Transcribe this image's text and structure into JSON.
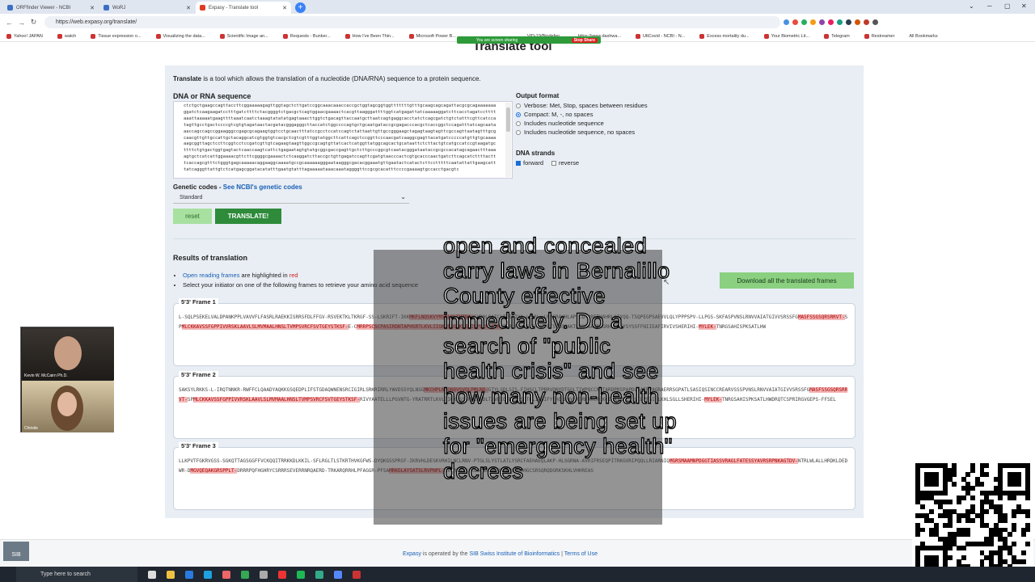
{
  "browser": {
    "tabs": [
      {
        "title": "ORFfinder Viewer - NCBI"
      },
      {
        "title": "WoRJ"
      },
      {
        "title": "Expasy - Translate tool",
        "active": true
      }
    ],
    "url": "https://web.expasy.org/translate/",
    "bookmarks": [
      "Yahoo! JAPAN",
      "watch",
      "Tissue expression o...",
      "Visualizing the data...",
      "Scientific Image an...",
      "Requests - Bunker...",
      "How I've Been Thin...",
      "Microsoft Power B...",
      "VID-19/Biodefen...",
      "https://www.dashwa...",
      "UltCovid - NCBI - N...",
      "Excess mortality du...",
      "Your Biometric Lit...",
      "Telegram",
      "Restreamer",
      "All Bookmarks"
    ],
    "share_text": "You are screen sharing",
    "stop_share": "Stop Share"
  },
  "page": {
    "title": "Translate tool",
    "intro_bold": "Translate",
    "intro_rest": " is a tool which allows the translation of a nucleotide (DNA/RNA) sequence to a protein sequence.",
    "seq_label": "DNA or RNA sequence",
    "sequence": "ctctgctgaagccagttaccttcggaaaaagagttggtagctcttgatccggcaaacaaaccaccgctggtagcggtggtttttttgtttgcaagcagcagattacgcgcagaaaaaaaggatctcaagaagatcctttgatcttttctacggggtctgacgctcagtggaacgaaaactcacgttaagggattttggtcatgagattatcaaaaaggatcttcacctagatccttttaaattaaaaatgaagttttaaatcaatctaaagtatatatgagtaaacttggtctgacagttaccaatgcttaatcagtgaggcacctatctcagcgatctgtctatttcgttcatccatagttgcctgactccccgtcgtgtagataactacgatacgggagggcttaccatctggccccagtgctgcaatgataccgcgagacccacgctcaccggctccagatttatcagcaataaaccagccagccggaagggccgagcgcagaagtggtcctgcaactttatccgcctccatccagtctattaattgttgccgggaagctagagtaagtagttcgccagttaatagtttgcgcaacgttgttgccattgctacaggcatcgtggtgtcacgctcgtcgtttggtatggcttcattcagctccggttcccaacgatcaaggcgagttacatgatcccccatgttgtgcaaaaaagcggttagctccttcggtcctccgatcgttgtcagaagtaagttggccgcagtgttatcactcatggttatggcagcactgcataattctcttactgtcatgccatccgtaagatgcttttctgtgactggtgagtactcaaccaagtcattctgagaatagtgtatgcggcgaccgagttgctcttgcccggcgtcaatacgggataataccgcgccacatagcagaactttaaaagtgctcatcattggaaaacgttcttcggggcgaaaactctcaaggatcttaccgctgttgagatccagttcgatgtaacccactcgtgcacccaactgatcttcagcatcttttactttcaccagcgtttctgggtgagcaaaaacaggaaggcaaaatgccgcaaaaaagggaataagggcgacacggaaatgttgaatactcatactcttcctttttcaatattattgaagcatttatcagggttattgtctcatgagcggatacatatttgaatgtatttagaaaaataaacaaataggggttccgcgcacatttccccgaaaagtgccacctgacgtc",
    "output_format": {
      "title": "Output format",
      "options": [
        {
          "label": "Verbose: Met, Stop, spaces between residues",
          "selected": false
        },
        {
          "label": "Compact: M, -, no spaces",
          "selected": true
        },
        {
          "label": "Includes nucleotide sequence",
          "selected": false
        },
        {
          "label": "Includes nucleotide sequence, no spaces",
          "selected": false
        }
      ]
    },
    "dna_strands": {
      "title": "DNA strands",
      "forward": "forward",
      "reverse": "reverse"
    },
    "genetic_codes_label": "Genetic codes - ",
    "genetic_codes_link": "See NCBI's genetic codes",
    "genetic_code_selected": "Standard",
    "reset_label": "reset",
    "translate_label": "TRANSLATE!",
    "results_title": "Results of translation",
    "orf_link": "Open reading frames",
    "orf_mid": " are highlighted in ",
    "orf_red": "red",
    "select_hint": "Select your initiator on one of the following frames to retrieve your amino acid sequence",
    "download_label": "Download all the translated frames",
    "frames": [
      {
        "label": "5'3' Frame 1",
        "seq": "L-SQLPSEKELVALDPANKPPLVAVVFLFASRLRAEKKISRRSFDLFFGV-RSVEKTKLTKRGF-SS-LSKRIFT-IKKMKFLNQSKVYMSKLGLTVTNA-SVRHLSAICLFRSSIVA-LPVV--LRYGRAYHLAPVLQ-YRETHAHRLQIYQQ-TSQPEGPSAEVVLQLYPPPSPV-LLPGS-SKFASPVNSLRNVVAIATGIVVSRSSFGMASFSSGSQRSRRVT-SPMLCKKAVSSFGPPIVVRSKLAAVLSLMVMAALHNSLTVMPSVRCFSVTGEYSTKSF-E-CMRRPSCSCPASIRDNTAPHSRTLKVLIIGKRSSGRKLSRILPLLRSSSM-PTRAPN-SSAS-YFPFTSVSGGAKTGRQNAAKREGRHGNVEYSYSSFFNIIEAFIRVIVSHERIHI-MYLEK-TNRGSAHISPKSATLHW"
      },
      {
        "label": "5'3' Frame 2",
        "seq": "SAKSYLRKKS-L-IRQTNNKR-RWFFCLQAADYAQKKGSQEDPLIFSTGDAQWNENSRCIGIRLSRKRIRRLYWVDSSYQLNSGMKCHPLNLGNQVSVQLPMLNQ-GTYLSDLSIS-FIHSCLTPRRVDNYDTGGLTIWPQCCNDTARDPRSPAPDLSAIRPAGRAERRSGPATLSASIQSINCCREARVSSSPVNSLRNVVAIATGIVVSRSSFGMASFSSGSQRSRRVT-SPMLCKKAVSSFGPPIVVRSKLAAVLSLMVMAALHNSLTVMPSVRCFSVTGEYSTKSF-RIVYAATELLLPGVNTG-YRATRRTLKVLIIGKRSSGRKLSKDLTAVEIQFDVTHSCTQLIFSIFYFHQRFWVSKNRKAKCRKKGIRATRKC-ILILPFSILLKHLSGLLSHERIHI-MYLEK-TNRGSAHISPKSATLHWDRQTCSPRIRGVGEPS-FFSEL"
      },
      {
        "label": "5'3' Frame 3",
        "seq": "LLKPVTFGKRVGSS-SGKQTTAGSGGFFVCKQQITRRKKDLKKIL-SFLRGLTLSTKRTHVKGFWS-DYQKGSSPRSF-IKRVHLDESKVRHILNCLRNV-PTGLSLYSTLATLYSRCFAEHAEQLAKP-HLSGRNA-AVRIFRSEQPITRKGVRIPQQLLRIARNIQMGRSMAAMNPDGGTIASSVRAGLFATESSYAVRSRPNKAGTDV-NTRLWLALLHRDKLDEDWR-DMGVQEQAKGRSPPLT-DRRRPQFHGHRYCSRRRSEVERRNRQAERD-TRKARQRRHLPFAGGR-PFSAMRKGLAYSATSLRVPNPL-RVIRHSIA-KGCGGKGNQRRPRRVAHRHGCSRSQRQDGRKSKHLVHHREAS"
      }
    ],
    "footer_expasy": "Expasy",
    "footer_mid": " is operated by the ",
    "footer_sib": "SIB Swiss Institute of Bioinformatics",
    "footer_sep": " | ",
    "footer_terms": "Terms of Use",
    "sib_logo": "SIB"
  },
  "overlay": {
    "caption": "open and concealed carry laws in Bernalillo County effective immediately. Do a search of \"public health crisis\" and see how many non-health issues are being set up for \"emergency health\" decrees"
  },
  "video": {
    "participant1": "Kevin W. McCairn Ph.D.",
    "participant2": "Christie"
  },
  "taskbar": {
    "search_placeholder": "Type here to search"
  }
}
